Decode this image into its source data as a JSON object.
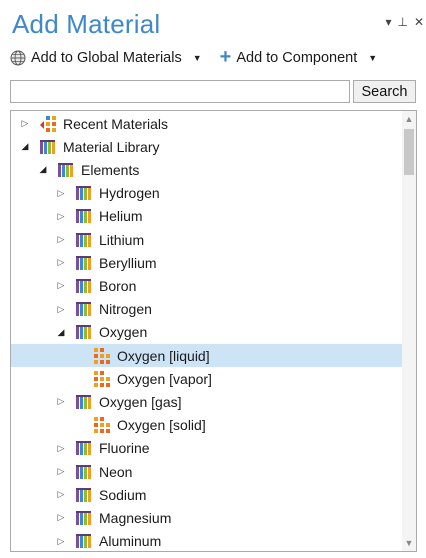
{
  "panel": {
    "title": "Add Material"
  },
  "window_controls": {
    "dropdown": "▾",
    "pin": "⊥",
    "close": "✕"
  },
  "toolbar": {
    "add_global_label": "Add to Global Materials",
    "add_component_label": "Add to Component",
    "dropdown_arrow": "▼"
  },
  "search": {
    "value": "",
    "placeholder": "",
    "button_label": "Search"
  },
  "tree": {
    "items": [
      {
        "label": "Recent Materials",
        "icon": "recent-materials-icon",
        "expanded": false
      },
      {
        "label": "Material Library",
        "icon": "material-library-icon",
        "expanded": true
      },
      {
        "label": "Elements",
        "icon": "library-folder-icon",
        "expanded": true
      },
      {
        "label": "Hydrogen",
        "icon": "library-folder-icon",
        "expanded": false
      },
      {
        "label": "Helium",
        "icon": "library-folder-icon",
        "expanded": false
      },
      {
        "label": "Lithium",
        "icon": "library-folder-icon",
        "expanded": false
      },
      {
        "label": "Beryllium",
        "icon": "library-folder-icon",
        "expanded": false
      },
      {
        "label": "Boron",
        "icon": "library-folder-icon",
        "expanded": false
      },
      {
        "label": "Nitrogen",
        "icon": "library-folder-icon",
        "expanded": false
      },
      {
        "label": "Oxygen",
        "icon": "library-folder-icon",
        "expanded": true
      },
      {
        "label": "Oxygen [liquid]",
        "icon": "material-icon",
        "selected": true
      },
      {
        "label": "Oxygen [vapor]",
        "icon": "material-icon"
      },
      {
        "label": "Oxygen [gas]",
        "icon": "library-folder-icon",
        "expanded": false
      },
      {
        "label": "Oxygen [solid]",
        "icon": "material-icon"
      },
      {
        "label": "Fluorine",
        "icon": "library-folder-icon",
        "expanded": false
      },
      {
        "label": "Neon",
        "icon": "library-folder-icon",
        "expanded": false
      },
      {
        "label": "Sodium",
        "icon": "library-folder-icon",
        "expanded": false
      },
      {
        "label": "Magnesium",
        "icon": "library-folder-icon",
        "expanded": false
      },
      {
        "label": "Aluminum",
        "icon": "library-folder-icon",
        "expanded": false
      }
    ]
  },
  "colors": {
    "title": "#3f88c9",
    "selection": "#cde4f7",
    "plus": "#3f88c9"
  }
}
